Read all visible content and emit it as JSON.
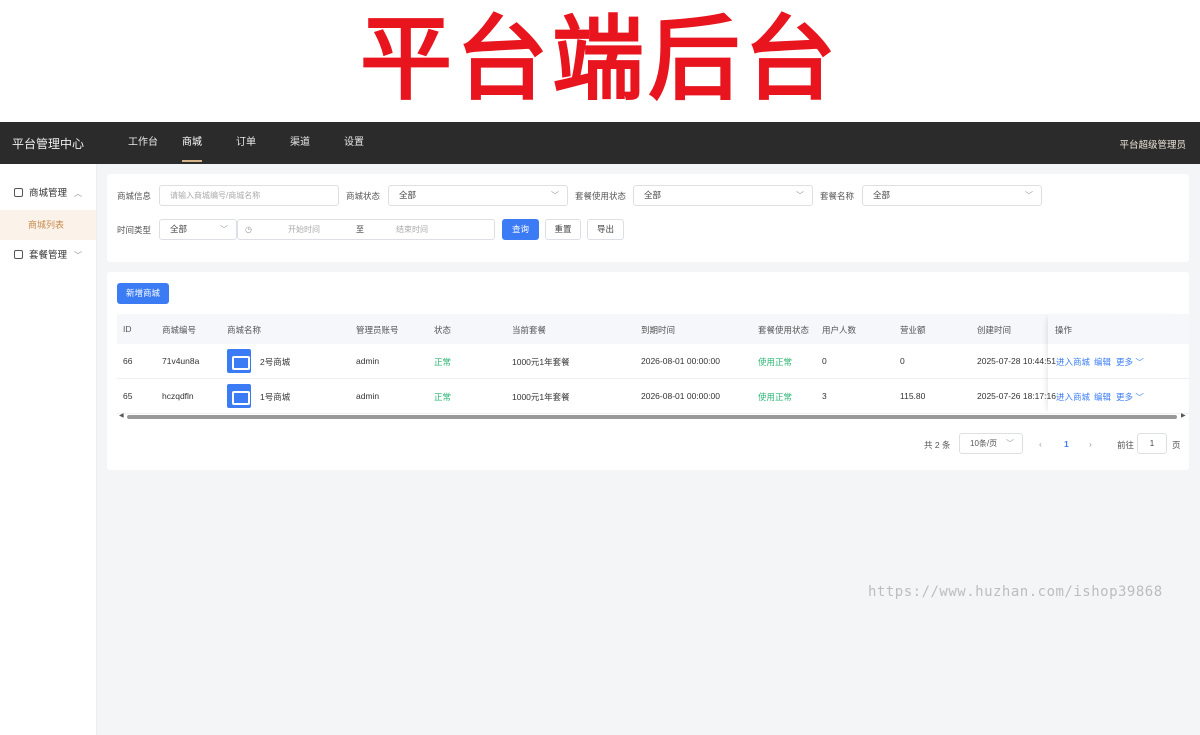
{
  "banner": {
    "title": "平台端后台"
  },
  "topbar": {
    "app_title": "平台管理中心",
    "nav": [
      "工作台",
      "商城",
      "订单",
      "渠道",
      "设置"
    ],
    "active_nav": "商城",
    "user": "平台超级管理员"
  },
  "sidebar": {
    "group1": {
      "label": "商城管理",
      "icon": "shop-icon",
      "chevron": "︿"
    },
    "group1_item": "商城列表",
    "group2": {
      "label": "套餐管理",
      "icon": "clipboard-icon",
      "chevron": "﹀"
    }
  },
  "filters": {
    "shop_info_label": "商城信息",
    "shop_info_placeholder": "请输入商城编号/商城名称",
    "shop_status_label": "商城状态",
    "shop_status_value": "全部",
    "pkg_status_label": "套餐使用状态",
    "pkg_status_value": "全部",
    "pkg_name_label": "套餐名称",
    "pkg_name_value": "全部",
    "time_type_label": "时间类型",
    "time_type_value": "全部",
    "start_placeholder": "开始时间",
    "range_sep": "至",
    "end_placeholder": "结束时间",
    "query_btn": "查询",
    "reset_btn": "重置",
    "export_btn": "导出"
  },
  "table": {
    "add_btn": "新增商城",
    "headers": [
      "ID",
      "商城编号",
      "商城名称",
      "管理员账号",
      "状态",
      "当前套餐",
      "到期时间",
      "套餐使用状态",
      "用户人数",
      "营业额",
      "创建时间",
      "操作"
    ],
    "rows": [
      {
        "id": "66",
        "code": "71v4un8a",
        "name": "2号商城",
        "admin": "admin",
        "status": "正常",
        "package": "1000元1年套餐",
        "expire": "2026-08-01 00:00:00",
        "pkg_status": "使用正常",
        "users": "0",
        "revenue": "0",
        "created": "2025-07-28 10:44:51"
      },
      {
        "id": "65",
        "code": "hczqdfln",
        "name": "1号商城",
        "admin": "admin",
        "status": "正常",
        "package": "1000元1年套餐",
        "expire": "2026-08-01 00:00:00",
        "pkg_status": "使用正常",
        "users": "3",
        "revenue": "115.80",
        "created": "2025-07-26 18:17:16"
      }
    ],
    "ops": {
      "enter": "进入商城",
      "edit": "编辑",
      "more": "更多"
    }
  },
  "pagination": {
    "total": "共 2 条",
    "page_size": "10条/页",
    "current": "1",
    "goto_label": "前往",
    "goto_value": "1",
    "page_suffix": "页"
  },
  "watermark": "https://www.huzhan.com/ishop39868",
  "colors": {
    "accent": "#3b7cf5",
    "success": "#2bb673",
    "banner_red": "#e8141e",
    "topbar": "#2b2b2b",
    "sidebar_active": "#c58b4c"
  }
}
